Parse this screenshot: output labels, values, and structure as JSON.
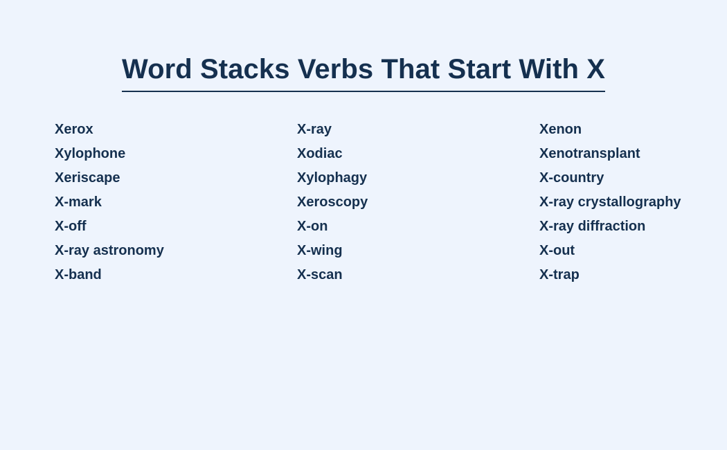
{
  "theme": {
    "background_color": "#eef4fd",
    "text_color": "#15304f",
    "rule_color": "#15304f"
  },
  "header": {
    "title": "Word Stacks Verbs That Start With X"
  },
  "word_list": {
    "columns": [
      {
        "items": [
          "Xerox",
          "Xylophone",
          "Xeriscape",
          "X-mark",
          "X-off",
          "X-ray astronomy",
          "X-band"
        ]
      },
      {
        "items": [
          "X-ray",
          "Xodiac",
          "Xylophagy",
          "Xeroscopy",
          "X-on",
          "X-wing",
          "X-scan"
        ]
      },
      {
        "items": [
          "Xenon",
          "Xenotransplant",
          "X-country",
          "X-ray crystallography",
          "X-ray diffraction",
          "X-out",
          "X-trap"
        ]
      }
    ]
  }
}
